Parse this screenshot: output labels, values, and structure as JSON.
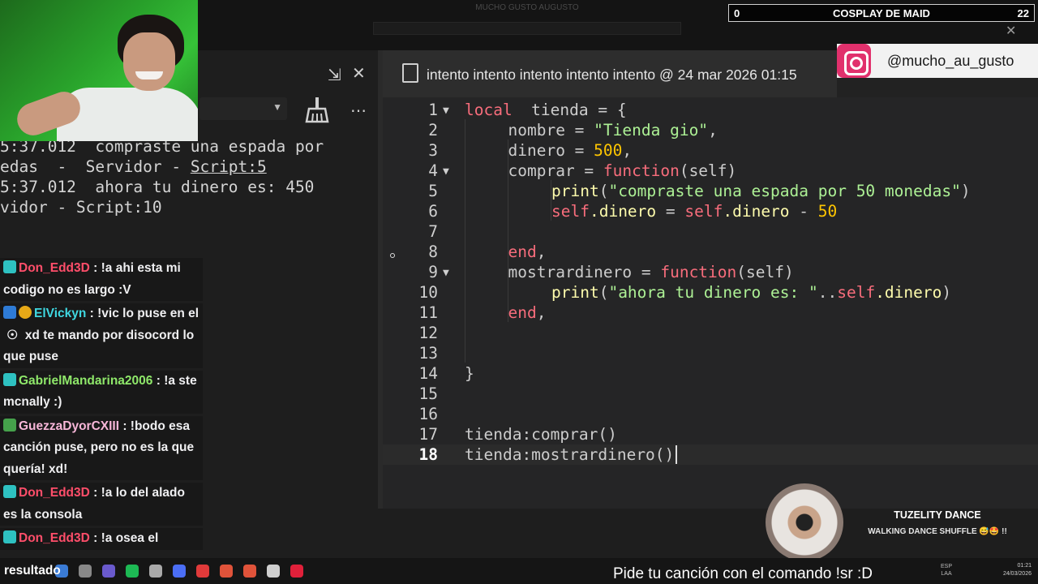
{
  "topbar": {
    "title": "MUCHO GUSTO AUGUSTO",
    "note": ""
  },
  "output": {
    "lines": [
      {
        "pre": "5:37.012  compraste una espada por",
        "link": "",
        "post": ""
      },
      {
        "pre": "edas  -  Servidor - ",
        "link": "Script:5",
        "post": ""
      },
      {
        "pre": "5:37.012  ahora tu dinero es: 450",
        "link": "",
        "post": ""
      },
      {
        "pre": "vidor - Script:10",
        "link": "",
        "post": ""
      }
    ],
    "popout_icon": "popout-icon",
    "close_icon": "close-icon",
    "broom_icon": "broom-icon",
    "more_icon": "more-icon"
  },
  "chat": {
    "messages": [
      {
        "user": "Don_Edd3D",
        "color": "#ff4e6a",
        "badges": [
          "teal"
        ],
        "text": " : !a ahi esta mi codigo no es largo :V"
      },
      {
        "user": "ElVickyn",
        "color": "#3fd7e0",
        "badges": [
          "blue",
          "gold"
        ],
        "text": " : !vic lo puse en el  ☉  xd te mando por disocord lo que puse"
      },
      {
        "user": "GabrielMandarina2006",
        "color": "#8fe86a",
        "badges": [
          "teal"
        ],
        "text": " : !a ste mcnally :)"
      },
      {
        "user": "GuezzaDyorCXIII",
        "color": "#f7b6d8",
        "badges": [
          "green"
        ],
        "text": " : !bodo esa canción puse, pero no es la que quería! xd!"
      },
      {
        "user": "Don_Edd3D",
        "color": "#ff4e6a",
        "badges": [
          "teal"
        ],
        "text": " : !a lo del alado es la consola"
      },
      {
        "user": "Don_Edd3D",
        "color": "#ff4e6a",
        "badges": [
          "teal"
        ],
        "text": " : !a osea el resultado"
      }
    ]
  },
  "editor": {
    "tab_title": "intento intento intento intento intento @ 24 mar 2026 01:15",
    "active_line": 18,
    "lines": [
      {
        "n": "1",
        "fold": "▼",
        "indent": 0,
        "tokens": [
          [
            "kw",
            "local"
          ],
          [
            "",
            "  tienda = {"
          ]
        ]
      },
      {
        "n": "2",
        "fold": "",
        "indent": 1,
        "tokens": [
          [
            "",
            "nombre = "
          ],
          [
            "str",
            "\"Tienda gio\""
          ],
          [
            "",
            ","
          ]
        ]
      },
      {
        "n": "3",
        "fold": "",
        "indent": 1,
        "tokens": [
          [
            "",
            "dinero = "
          ],
          [
            "num",
            "500"
          ],
          [
            "",
            ","
          ]
        ]
      },
      {
        "n": "4",
        "fold": "▼",
        "indent": 1,
        "tokens": [
          [
            "",
            "comprar = "
          ],
          [
            "kw",
            "function"
          ],
          [
            "",
            "(self)"
          ]
        ]
      },
      {
        "n": "5",
        "fold": "",
        "indent": 2,
        "tokens": [
          [
            "fn",
            "print"
          ],
          [
            "",
            "("
          ],
          [
            "str",
            "\"compraste una espada por 50 monedas\""
          ],
          [
            "",
            ")"
          ]
        ]
      },
      {
        "n": "6",
        "fold": "",
        "indent": 2,
        "tokens": [
          [
            "kw",
            "self"
          ],
          [
            "fn",
            ".dinero"
          ],
          [
            "",
            " = "
          ],
          [
            "kw",
            "self"
          ],
          [
            "fn",
            ".dinero"
          ],
          [
            "",
            " - "
          ],
          [
            "num",
            "50"
          ]
        ]
      },
      {
        "n": "7",
        "fold": "",
        "indent": 0,
        "tokens": []
      },
      {
        "n": "8",
        "fold": "",
        "indent": 1,
        "tokens": [
          [
            "kw",
            "end"
          ],
          [
            "",
            ","
          ]
        ]
      },
      {
        "n": "9",
        "fold": "▼",
        "indent": 1,
        "tokens": [
          [
            "",
            "mostrardinero = "
          ],
          [
            "kw",
            "function"
          ],
          [
            "",
            "(self)"
          ]
        ]
      },
      {
        "n": "10",
        "fold": "",
        "indent": 2,
        "tokens": [
          [
            "fn",
            "print"
          ],
          [
            "",
            "("
          ],
          [
            "str",
            "\"ahora tu dinero es: \""
          ],
          [
            "",
            ".."
          ],
          [
            "kw",
            "self"
          ],
          [
            "fn",
            ".dinero"
          ],
          [
            "",
            ")"
          ]
        ]
      },
      {
        "n": "11",
        "fold": "",
        "indent": 1,
        "tokens": [
          [
            "kw",
            "end"
          ],
          [
            "",
            ","
          ]
        ]
      },
      {
        "n": "12",
        "fold": "",
        "indent": 0,
        "tokens": []
      },
      {
        "n": "13",
        "fold": "",
        "indent": 0,
        "tokens": []
      },
      {
        "n": "14",
        "fold": "",
        "indent": 0,
        "tokens": [
          [
            "",
            "}"
          ]
        ]
      },
      {
        "n": "15",
        "fold": "",
        "indent": 0,
        "tokens": []
      },
      {
        "n": "16",
        "fold": "",
        "indent": 0,
        "tokens": []
      },
      {
        "n": "17",
        "fold": "",
        "indent": 0,
        "tokens": [
          [
            "",
            "tienda:comprar()"
          ]
        ]
      },
      {
        "n": "18",
        "fold": "",
        "indent": 0,
        "tokens": [
          [
            "",
            "tienda:mostrardinero()"
          ]
        ]
      }
    ]
  },
  "overlays": {
    "cosplay_left": "0",
    "cosplay_title": "COSPLAY DE MAID",
    "cosplay_right": "22",
    "instagram_handle": "@mucho_au_gusto",
    "music_title": "TUZELITY DANCE",
    "music_artist": "WALKING DANCE SHUFFLE 😅🤩 !!",
    "promo": "Pide tu canción con el comando !sr :D",
    "result_word": "resultado"
  },
  "taskbar": {
    "icons": [
      "#3a7bd5",
      "#888",
      "#6a5acd",
      "#1db954",
      "#aaa",
      "#4b6ef5",
      "#e03a3a",
      "#e0533a",
      "#e0533a",
      "#cfcfcf",
      "#e0203a"
    ],
    "lang": "ESP",
    "lang2": "LAA",
    "time": "01:21",
    "date": "24/03/2026"
  },
  "colors": {
    "keyword": "#f86d7c",
    "string": "#adf195",
    "number": "#ffc600",
    "builtin": "#fdfbac"
  }
}
